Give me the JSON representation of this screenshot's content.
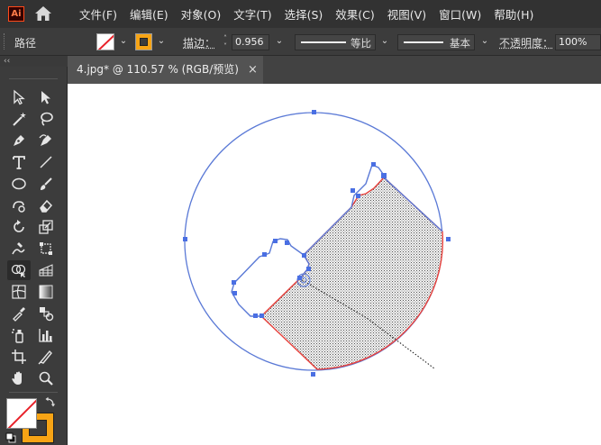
{
  "app": {
    "logo_text": "Ai"
  },
  "menu": {
    "items": [
      {
        "label": "文件(F)"
      },
      {
        "label": "编辑(E)"
      },
      {
        "label": "对象(O)"
      },
      {
        "label": "文字(T)"
      },
      {
        "label": "选择(S)"
      },
      {
        "label": "效果(C)"
      },
      {
        "label": "视图(V)"
      },
      {
        "label": "窗口(W)"
      },
      {
        "label": "帮助(H)"
      }
    ]
  },
  "control": {
    "selection_type": "路径",
    "stroke_label": "描边：",
    "stroke_weight": "0.956",
    "profile_label": "等比",
    "brush_label": "基本",
    "opacity_label": "不透明度：",
    "opacity_value": "100%"
  },
  "document": {
    "tab_title": "4.jpg* @ 110.57 % (RGB/预览)",
    "close_symbol": "×"
  },
  "colors": {
    "stroke_accent": "#f7a415",
    "path_outline": "#5a79d6",
    "shape_outline": "#e8413c",
    "anchor": "#4a6fe3"
  },
  "tools": [
    "selection-tool",
    "direct-selection-tool",
    "magic-wand-tool",
    "lasso-tool",
    "pen-tool",
    "curvature-tool",
    "type-tool",
    "line-segment-tool",
    "ellipse-tool",
    "paintbrush-tool",
    "shaper-tool",
    "eraser-tool",
    "rotate-tool",
    "scale-tool",
    "warp-tool",
    "free-transform-tool",
    "shape-builder-tool",
    "perspective-grid-tool",
    "mesh-tool",
    "gradient-tool",
    "eyedropper-tool",
    "blend-tool",
    "symbol-sprayer-tool",
    "column-graph-tool",
    "artboard-tool",
    "slice-tool",
    "hand-tool",
    "zoom-tool"
  ]
}
